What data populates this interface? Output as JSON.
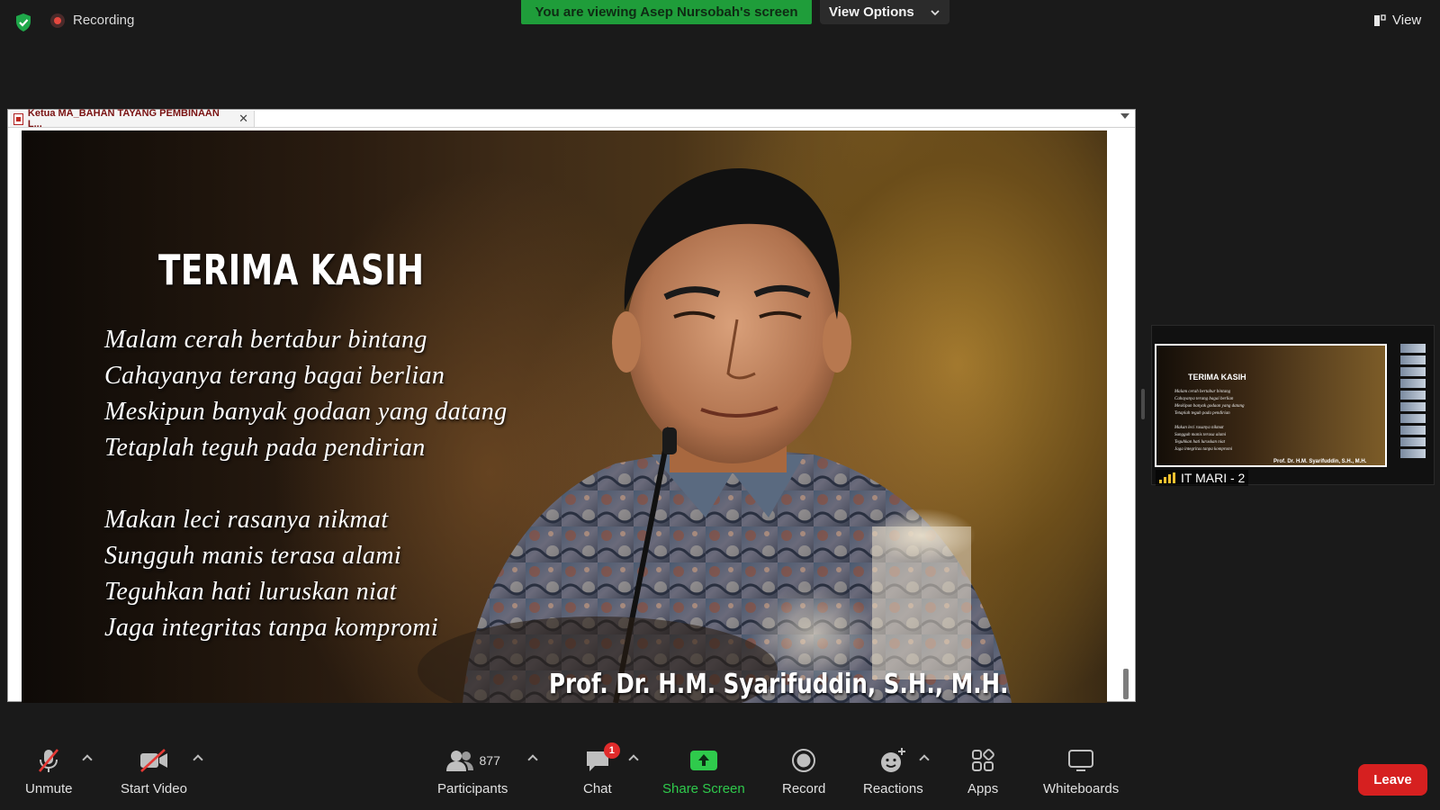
{
  "topbar": {
    "recording_label": "Recording",
    "viewing_banner": "You are viewing Asep Nursobah's screen",
    "view_options_label": "View Options",
    "view_label": "View"
  },
  "document": {
    "tab_title": "Ketua MA_BAHAN TAYANG PEMBINAAN L..."
  },
  "slide": {
    "title": "TERIMA KASIH",
    "stanza1": [
      "Malam cerah bertabur bintang",
      "Cahayanya terang bagai berlian",
      "Meskipun banyak godaan yang datang",
      "Tetaplah teguh pada pendirian"
    ],
    "stanza2": [
      "Makan leci rasanya nikmat",
      "Sungguh manis terasa alami",
      "Teguhkan hati luruskan niat",
      "Jaga integritas tanpa kompromi"
    ],
    "signature": "Prof. Dr. H.M. Syarifuddin, S.H., M.H."
  },
  "thumbnail": {
    "participant_name": "IT MARI - 2",
    "slide_title": "TERIMA KASIH"
  },
  "toolbar": {
    "unmute": "Unmute",
    "start_video": "Start Video",
    "participants": "Participants",
    "participants_count": "877",
    "chat": "Chat",
    "chat_badge": "1",
    "share_screen": "Share Screen",
    "record": "Record",
    "reactions": "Reactions",
    "apps": "Apps",
    "whiteboards": "Whiteboards",
    "leave": "Leave"
  },
  "colors": {
    "background": "#1a1a1a",
    "viewing_banner": "#1f9d3a",
    "leave_button": "#d62020",
    "share_icon": "#2fca4c",
    "badge": "#e02b2b"
  }
}
